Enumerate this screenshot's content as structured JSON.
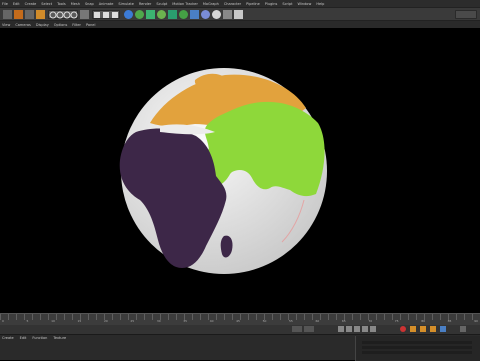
{
  "menubar": {
    "items": [
      "File",
      "Edit",
      "Create",
      "Select",
      "Tools",
      "Mesh",
      "Snap",
      "Animate",
      "Simulate",
      "Render",
      "Sculpt",
      "Motion Tracker",
      "MoGraph",
      "Character",
      "Pipeline",
      "Plugins",
      "Script",
      "Window",
      "Help"
    ]
  },
  "viewport_menu": {
    "items": [
      "View",
      "Cameras",
      "Display",
      "Options",
      "Filter",
      "Panel"
    ]
  },
  "timeline": {
    "frames": [
      "0",
      "5",
      "10",
      "15",
      "20",
      "25",
      "30",
      "35",
      "40",
      "45",
      "50",
      "55",
      "60",
      "65",
      "70",
      "75",
      "80",
      "85",
      "90"
    ]
  },
  "bottom_panel": {
    "tabs": [
      "Create",
      "Edit",
      "Function",
      "Texture"
    ]
  },
  "colors": {
    "africa": "#3d2748",
    "asia": "#8ed83a",
    "europe": "#e2a23d",
    "ocean": "#ececec",
    "background": "#000000"
  }
}
